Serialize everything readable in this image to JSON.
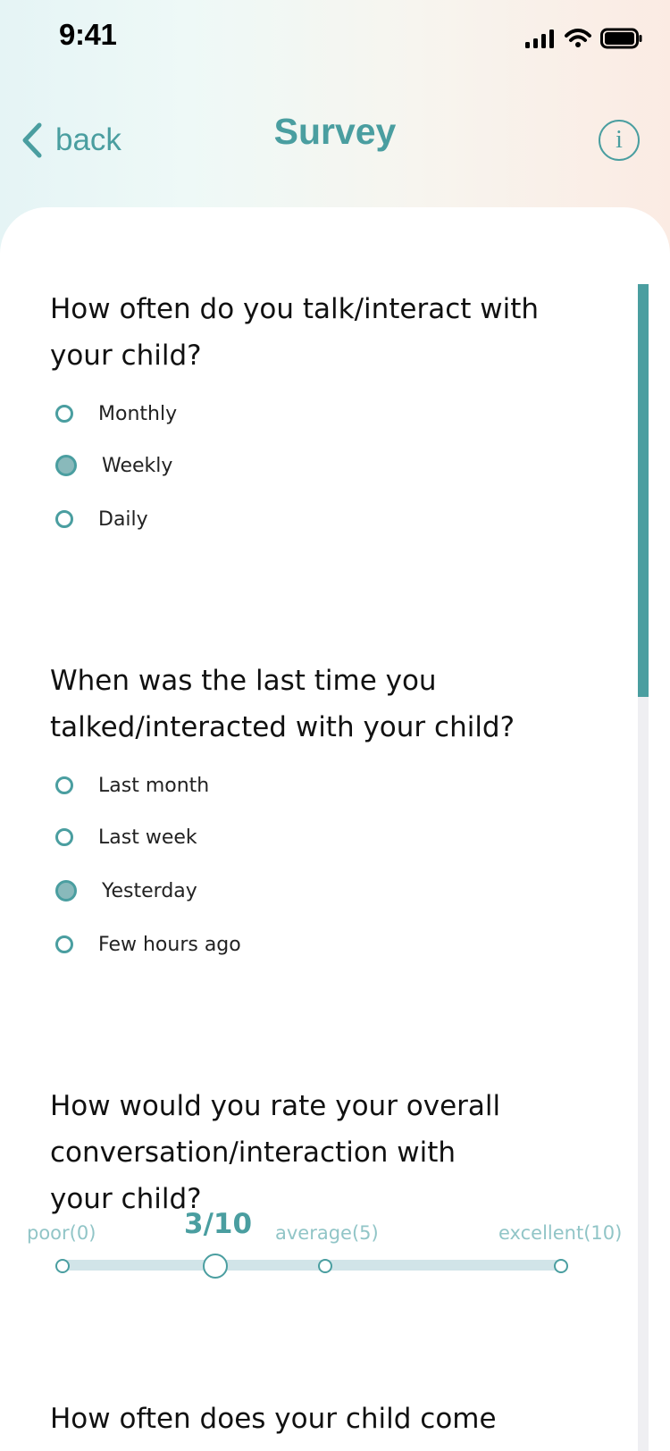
{
  "status_bar": {
    "time": "9:41",
    "icons": [
      "signal-icon",
      "wifi-icon",
      "battery-icon"
    ]
  },
  "header": {
    "back_label": "back",
    "title": "Survey",
    "info_label": "i"
  },
  "theme": {
    "accent": "#4a9ea0",
    "light_accent": "#91c5c7",
    "track": "#d1e4e8",
    "background_left": "#e5f4f5",
    "background_right": "#fbebe3"
  },
  "survey": {
    "questions": [
      {
        "text": "How often do you talk/interact with your child?",
        "options": [
          {
            "label": "Monthly",
            "selected": false
          },
          {
            "label": "Weekly",
            "selected": true
          },
          {
            "label": "Daily",
            "selected": false
          }
        ]
      },
      {
        "text": "When was the last time you talked/interacted with your child?",
        "options": [
          {
            "label": "Last month",
            "selected": false
          },
          {
            "label": "Last week",
            "selected": false
          },
          {
            "label": "Yesterday",
            "selected": true
          },
          {
            "label": "Few hours ago",
            "selected": false
          }
        ]
      },
      {
        "text": "How would you rate your overall conversation/interaction with your child?",
        "rating": {
          "value_text": "3/10",
          "value": 3,
          "min": 0,
          "max": 10,
          "labels": {
            "poor": "poor(0)",
            "average": "average(5)",
            "excellent": "excellent(10)"
          }
        }
      },
      {
        "text": "How often does your child come"
      }
    ]
  },
  "scroll": {
    "position": 0
  }
}
